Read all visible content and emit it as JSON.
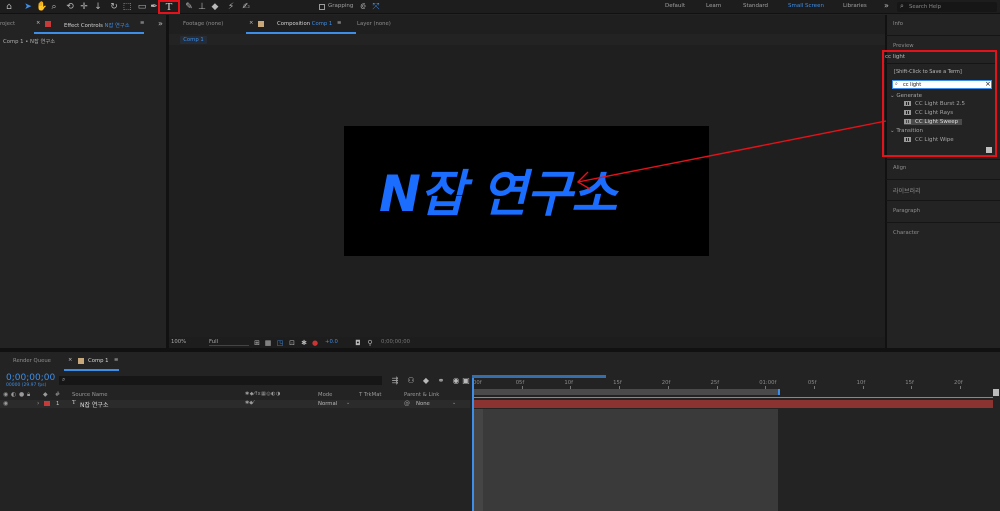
{
  "toolbar": {
    "grapping_label": "Grapping",
    "workspaces": [
      "Default",
      "Learn",
      "Standard",
      "Small Screen",
      "Libraries"
    ],
    "active_workspace": "Small Screen",
    "search_placeholder": "Search Help",
    "overflow_glyph": "»"
  },
  "project_tab": {
    "label": "roject"
  },
  "effect_controls": {
    "tab_label": "Effect Controls",
    "tab_layer": "N잡 연구소",
    "breadcrumb": "Comp 1 • N잡 연구소",
    "menu_glyph": "≡",
    "close_glyph": "×"
  },
  "footage_tab": {
    "label": "Footage",
    "value": "(none)"
  },
  "composition_tab": {
    "label": "Composition",
    "comp": "Comp 1",
    "menu_glyph": "≡"
  },
  "layer_tab": {
    "label": "Layer",
    "value": "(none)"
  },
  "comp_chip": "Comp 1",
  "comp_text": "N잡 연구소",
  "viewer_footer": {
    "zoom": "100%",
    "resolution": "Full",
    "exposure": "+0.0",
    "timecode": "0;00;00;00"
  },
  "right_panel": {
    "info": "Info",
    "preview": "Preview",
    "effects_title": "cc light",
    "save_term": "[Shift-Click to Save a Term]",
    "search_value": "cc light",
    "clear_glyph": "×",
    "categories": [
      {
        "name": "Generate",
        "items": [
          "CC Light Burst 2.5",
          "CC Light Rays",
          "CC Light Sweep"
        ]
      },
      {
        "name": "Transition",
        "items": [
          "CC Light Wipe"
        ]
      }
    ],
    "align": "Align",
    "library": "라이브러리",
    "paragraph": "Paragraph",
    "character": "Character"
  },
  "timeline": {
    "render_queue": "Render Queue",
    "comp_tab": "Comp 1",
    "menu_glyph": "≡",
    "timecode": "0;00;00;00",
    "fps": "00000 (29.97 fps)",
    "headers": {
      "source_name": "Source Name",
      "mode": "Mode",
      "trkmat": "T TrkMat",
      "parent": "Parent & Link"
    },
    "layer": {
      "number": "1",
      "type_glyph": "T",
      "name": "N잡 연구소",
      "mode": "Normal",
      "parent": "None"
    },
    "ruler": [
      "00f",
      "05f",
      "10f",
      "15f",
      "20f",
      "25f",
      "01:00f",
      "05f",
      "10f",
      "15f",
      "20f"
    ]
  },
  "colors": {
    "accent": "#3d8ee8",
    "highlight": "#e4121a",
    "comp_text": "#1a6dff",
    "layer_bar": "#8b3330"
  }
}
